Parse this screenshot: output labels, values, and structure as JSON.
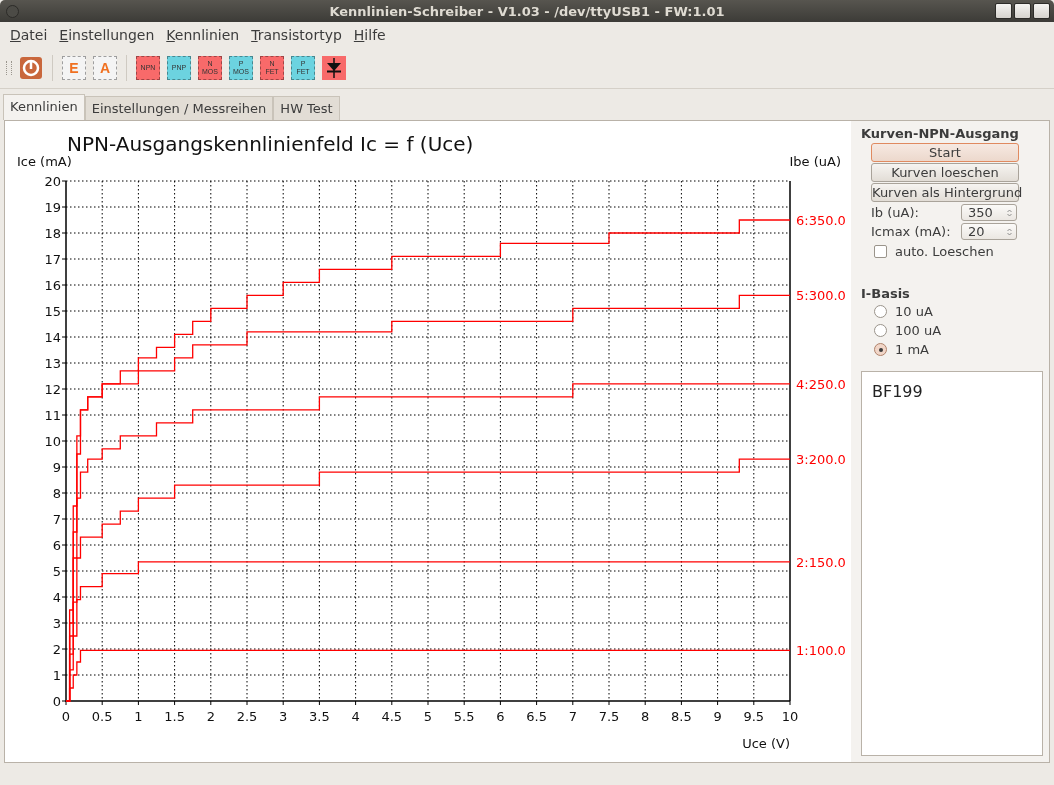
{
  "window": {
    "title": "Kennlinien-Schreiber - V1.03 - /dev/ttyUSB1 - FW:1.01"
  },
  "menu": [
    {
      "label": "Datei"
    },
    {
      "label": "Einstellungen"
    },
    {
      "label": "Kennlinien"
    },
    {
      "label": "Transistortyp"
    },
    {
      "label": "Hilfe"
    }
  ],
  "toolbar": [
    {
      "kind": "power"
    },
    {
      "kind": "chart",
      "label": "E"
    },
    {
      "kind": "chart",
      "label": "A"
    },
    {
      "kind": "type",
      "lines": [
        "NPN"
      ],
      "color": "#f86a6a"
    },
    {
      "kind": "type",
      "lines": [
        "PNP"
      ],
      "color": "#6cd3e0"
    },
    {
      "kind": "type",
      "lines": [
        "N",
        "MOS"
      ],
      "color": "#f86a6a"
    },
    {
      "kind": "type",
      "lines": [
        "P",
        "MOS"
      ],
      "color": "#6cd3e0"
    },
    {
      "kind": "type",
      "lines": [
        "N",
        "FET"
      ],
      "color": "#f86a6a"
    },
    {
      "kind": "type",
      "lines": [
        "P",
        "FET"
      ],
      "color": "#6cd3e0"
    },
    {
      "kind": "diode",
      "color": "#f86a6a"
    }
  ],
  "tabs": [
    {
      "label": "Kennlinien",
      "selected": true
    },
    {
      "label": "Einstellungen / Messreihen",
      "selected": false
    },
    {
      "label": "HW Test",
      "selected": false
    }
  ],
  "plot": {
    "right_axis_label": "Ibe (uA)",
    "chart_data": {
      "type": "line",
      "title": "NPN-Ausgangskennlinienfeld Ic = f (Uce)",
      "xlabel": "Uce (V)",
      "ylabel": "Ice (mA)",
      "grid": true,
      "x": [
        0,
        0.05,
        0.05,
        0.1,
        0.1,
        0.15,
        0.15,
        0.2,
        0.2,
        0.3,
        0.3,
        0.5,
        0.5,
        0.75,
        0.75,
        1,
        1,
        1.25,
        1.25,
        1.5,
        1.5,
        1.75,
        1.75,
        2,
        2,
        2.5,
        2.5,
        3,
        3,
        3.5,
        3.5,
        4,
        4,
        4.5,
        4.5,
        5,
        5,
        6,
        6,
        7,
        7,
        7.5,
        7.5,
        8,
        8,
        9,
        9,
        9.3,
        9.3,
        10,
        10
      ],
      "series": [
        {
          "name": "1:100.0",
          "color": "#ff0000",
          "values": [
            0,
            0,
            0.5,
            0.5,
            1,
            1,
            1.5,
            1.5,
            1.95,
            1.95,
            1.95,
            1.95,
            1.95,
            1.95,
            1.95,
            1.95,
            1.95,
            1.95,
            1.95,
            1.95,
            1.95,
            1.95,
            1.95,
            1.95,
            1.95,
            1.95,
            1.95,
            1.95,
            1.95,
            1.95,
            1.95,
            1.95,
            1.95,
            1.95,
            1.95,
            1.95,
            1.95,
            1.95,
            1.95,
            1.95,
            1.95,
            1.95,
            1.95,
            1.95,
            1.95,
            1.95,
            1.95,
            1.95,
            1.95,
            1.95,
            1.95
          ]
        },
        {
          "name": "2:150.0",
          "color": "#ff0000",
          "values": [
            0,
            0,
            1.2,
            1.2,
            2.5,
            2.5,
            3.9,
            3.9,
            4.4,
            4.4,
            4.4,
            4.4,
            4.9,
            4.9,
            4.9,
            4.9,
            5.35,
            5.35,
            5.35,
            5.35,
            5.35,
            5.35,
            5.35,
            5.35,
            5.35,
            5.35,
            5.35,
            5.35,
            5.35,
            5.35,
            5.35,
            5.35,
            5.35,
            5.35,
            5.35,
            5.35,
            5.35,
            5.35,
            5.35,
            5.35,
            5.35,
            5.35,
            5.35,
            5.35,
            5.35,
            5.35,
            5.35,
            5.35,
            5.35,
            5.35,
            5.35
          ]
        },
        {
          "name": "3:200.0",
          "color": "#ff0000",
          "values": [
            0,
            0,
            1.8,
            1.8,
            3.8,
            3.8,
            5.5,
            5.5,
            6.3,
            6.3,
            6.3,
            6.3,
            6.8,
            6.8,
            7.3,
            7.3,
            7.8,
            7.8,
            7.8,
            7.8,
            8.3,
            8.3,
            8.3,
            8.3,
            8.3,
            8.3,
            8.3,
            8.3,
            8.3,
            8.3,
            8.8,
            8.8,
            8.8,
            8.8,
            8.8,
            8.8,
            8.8,
            8.8,
            8.8,
            8.8,
            8.8,
            8.8,
            8.8,
            8.8,
            8.8,
            8.8,
            8.8,
            8.8,
            9.3,
            9.3,
            9.3
          ]
        },
        {
          "name": "4:250.0",
          "color": "#ff0000",
          "values": [
            0,
            0,
            2.5,
            2.5,
            5.5,
            5.5,
            7.8,
            7.8,
            8.8,
            8.8,
            9.3,
            9.3,
            9.7,
            9.7,
            10.2,
            10.2,
            10.2,
            10.2,
            10.7,
            10.7,
            10.7,
            10.7,
            11.2,
            11.2,
            11.2,
            11.2,
            11.2,
            11.2,
            11.2,
            11.2,
            11.7,
            11.7,
            11.7,
            11.7,
            11.7,
            11.7,
            11.7,
            11.7,
            11.7,
            11.7,
            12.2,
            12.2,
            12.2,
            12.2,
            12.2,
            12.2,
            12.2,
            12.2,
            12.2,
            12.2,
            12.2
          ]
        },
        {
          "name": "5:300.0",
          "color": "#ff0000",
          "values": [
            0,
            0,
            3,
            3,
            6.5,
            6.5,
            9.5,
            9.5,
            11.2,
            11.2,
            11.7,
            11.7,
            12.2,
            12.2,
            12.2,
            12.2,
            12.7,
            12.7,
            12.7,
            12.7,
            13.2,
            13.2,
            13.7,
            13.7,
            13.7,
            13.7,
            14.2,
            14.2,
            14.2,
            14.2,
            14.2,
            14.2,
            14.2,
            14.2,
            14.6,
            14.6,
            14.6,
            14.6,
            14.6,
            14.6,
            15.1,
            15.1,
            15.1,
            15.1,
            15.1,
            15.1,
            15.1,
            15.1,
            15.6,
            15.6,
            15.6
          ]
        },
        {
          "name": "6:350.0",
          "color": "#ff0000",
          "values": [
            0,
            0,
            3.5,
            3.5,
            7.5,
            7.5,
            10.2,
            10.2,
            11.2,
            11.2,
            11.7,
            11.7,
            12.2,
            12.2,
            12.7,
            12.7,
            13.2,
            13.2,
            13.6,
            13.6,
            14.1,
            14.1,
            14.6,
            14.6,
            15.1,
            15.1,
            15.6,
            15.6,
            16.1,
            16.1,
            16.6,
            16.6,
            16.6,
            16.6,
            17.1,
            17.1,
            17.1,
            17.1,
            17.6,
            17.6,
            17.6,
            17.6,
            18,
            18,
            18,
            18,
            18,
            18,
            18.5,
            18.5,
            18.5
          ]
        }
      ],
      "xlim": [
        0,
        10
      ],
      "ylim": [
        0,
        20
      ],
      "xticks": [
        0,
        0.5,
        1,
        1.5,
        2,
        2.5,
        3,
        3.5,
        4,
        4.5,
        5,
        5.5,
        6,
        6.5,
        7,
        7.5,
        8,
        8.5,
        9,
        9.5,
        10
      ],
      "yticks": [
        0,
        1,
        2,
        3,
        4,
        5,
        6,
        7,
        8,
        9,
        10,
        11,
        12,
        13,
        14,
        15,
        16,
        17,
        18,
        19,
        20
      ]
    }
  },
  "panel": {
    "title": "Kurven-NPN-Ausgang",
    "buttons": [
      {
        "label": "Start",
        "focused": true
      },
      {
        "label": "Kurven loeschen",
        "focused": false
      },
      {
        "label": "Kurven als Hintergrund",
        "focused": false
      }
    ],
    "fields": [
      {
        "label": "Ib (uA):",
        "value": "350"
      },
      {
        "label": "Icmax (mA):",
        "value": "20"
      }
    ],
    "checkbox": {
      "label": "auto. Loeschen",
      "checked": false
    },
    "basis_title": "I-Basis",
    "radios": [
      {
        "label": "10 uA",
        "selected": false
      },
      {
        "label": "100 uA",
        "selected": false
      },
      {
        "label": "1 mA",
        "selected": true
      }
    ],
    "notes": "BF199"
  }
}
